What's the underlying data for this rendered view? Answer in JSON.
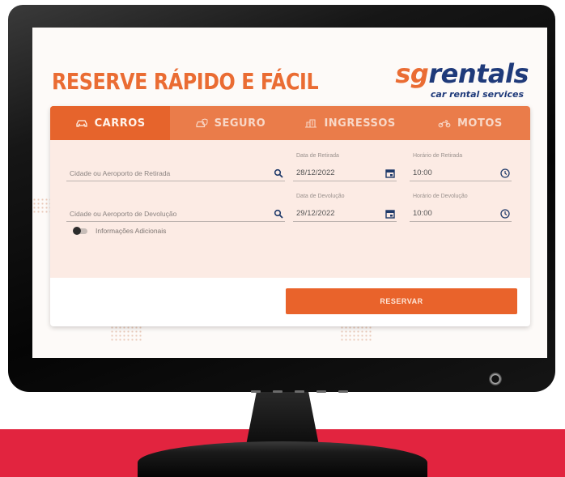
{
  "page": {
    "headline": "RESERVE RÁPIDO E FÁCIL"
  },
  "logo": {
    "sg": "sg",
    "rentals": "rentals",
    "tagline": "car rental services"
  },
  "tabs": [
    {
      "label": "CARROS",
      "icon": "car-icon",
      "active": true
    },
    {
      "label": "SEGURO",
      "icon": "insurance-car-icon",
      "active": false
    },
    {
      "label": "INGRESSOS",
      "icon": "building-icon",
      "active": false
    },
    {
      "label": "MOTOS",
      "icon": "motorcycle-icon",
      "active": false
    }
  ],
  "form": {
    "pickup_location": {
      "placeholder": "Cidade ou Aeroporto de Retirada",
      "icon": "search-icon"
    },
    "pickup_date": {
      "label": "Data de Retirada",
      "value": "28/12/2022",
      "icon": "calendar-icon"
    },
    "pickup_time": {
      "label": "Horário de Retirada",
      "value": "10:00",
      "icon": "clock-icon"
    },
    "return_location": {
      "placeholder": "Cidade ou Aeroporto de Devolução",
      "icon": "search-icon"
    },
    "return_date": {
      "label": "Data de Devolução",
      "value": "29/12/2022",
      "icon": "calendar-icon"
    },
    "return_time": {
      "label": "Horário de Devolução",
      "value": "10:00",
      "icon": "clock-icon"
    },
    "additional_info": {
      "label": "Informações Adicionais",
      "enabled": false
    }
  },
  "actions": {
    "reserve_label": "RESERVAR"
  },
  "colors": {
    "accent": "#ea6c33",
    "tab_bar": "#ea7c4a",
    "tab_active": "#e6642c",
    "form_bg": "#fcebe4",
    "brand_blue": "#1f3a7a",
    "band": "#e2243f"
  }
}
